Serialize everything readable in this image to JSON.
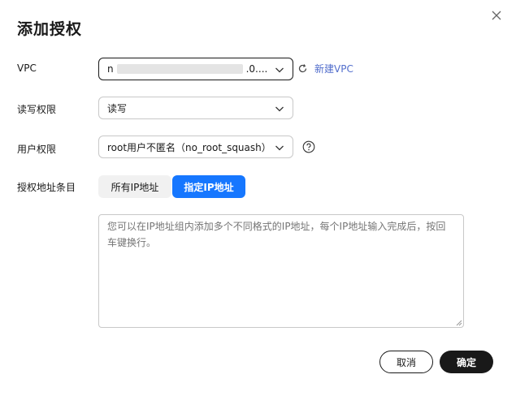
{
  "dialog": {
    "title": "添加授权"
  },
  "form": {
    "vpc": {
      "label": "VPC",
      "value_prefix": "n",
      "value_suffix": ".0....",
      "new_vpc_link": "新建VPC"
    },
    "rw_permission": {
      "label": "读写权限",
      "value": "读写"
    },
    "user_permission": {
      "label": "用户权限",
      "value": "root用户不匿名（no_root_squash）"
    },
    "auth_address": {
      "label": "授权地址条目",
      "options": [
        "所有IP地址",
        "指定IP地址"
      ],
      "selected": "指定IP地址",
      "placeholder": "您可以在IP地址组内添加多个不同格式的IP地址，每个IP地址输入完成后，按回车键换行。"
    }
  },
  "footer": {
    "cancel_label": "取消",
    "confirm_label": "确定"
  },
  "colors": {
    "accent": "#1677ff",
    "link": "#526ecc",
    "primary_button": "#191919"
  }
}
